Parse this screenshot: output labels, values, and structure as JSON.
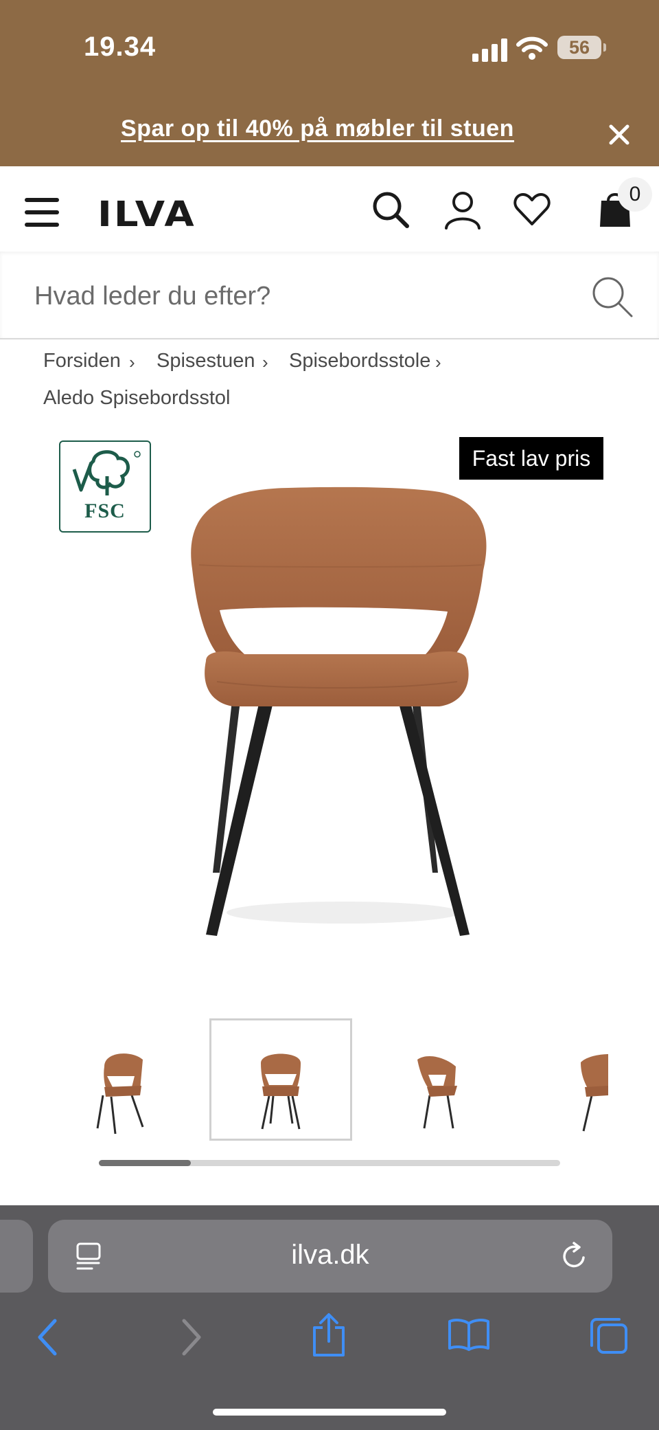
{
  "status_bar": {
    "time": "19.34",
    "battery": "56"
  },
  "promo": {
    "text": "Spar op til 40% på møbler til stuen"
  },
  "header": {
    "logo": "ILVA",
    "cart_count": "0"
  },
  "search": {
    "placeholder": "Hvad leder du efter?"
  },
  "breadcrumb": {
    "items": [
      "Forsiden",
      "Spisestuen",
      "Spisebordsstole",
      "Aledo Spisebordsstol"
    ],
    "separator": "›"
  },
  "product": {
    "certification": "FSC",
    "badge": "Fast lav pris",
    "thumbnails_count": 4,
    "selected_thumbnail": 2,
    "gallery_scroll_fraction": 0.2
  },
  "browser": {
    "url": "ilva.dk"
  },
  "colors": {
    "brand": "#8d6a45",
    "leather": "#a96a45",
    "safari": "#5b5a5d",
    "accent_blue": "#3f8ef5"
  },
  "icons": [
    "menu-icon",
    "search-icon",
    "user-icon",
    "heart-icon",
    "bag-icon",
    "close-icon",
    "tabs-icon",
    "reload-icon",
    "back-icon",
    "forward-icon",
    "share-icon",
    "bookmarks-icon",
    "tab-switcher-icon"
  ]
}
